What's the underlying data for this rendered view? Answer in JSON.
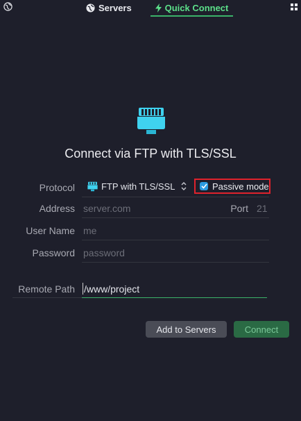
{
  "tabs": {
    "servers_label": "Servers",
    "quick_connect_label": "Quick Connect"
  },
  "heading": "Connect via FTP with TLS/SSL",
  "protocol": {
    "label": "Protocol",
    "selected": "FTP with TLS/SSL",
    "passive_mode_label": "Passive mode",
    "passive_mode_checked": true
  },
  "address": {
    "label": "Address",
    "placeholder": "server.com"
  },
  "port": {
    "label": "Port",
    "placeholder": "21"
  },
  "username": {
    "label": "User Name",
    "placeholder": "me"
  },
  "password": {
    "label": "Password",
    "placeholder": "password"
  },
  "remote_path": {
    "label": "Remote Path",
    "value": "/www/project"
  },
  "buttons": {
    "add_to_servers": "Add to Servers",
    "connect": "Connect"
  },
  "colors": {
    "background": "#1e1f2b",
    "accent_green": "#3bb36a",
    "icon_cyan": "#3fd2ef",
    "highlight_red": "#e0222c"
  },
  "icons": [
    "globe-icon",
    "lightning-icon",
    "grid-icon",
    "ethernet-port-icon",
    "checkmark-icon",
    "updown-chevron-icon"
  ]
}
